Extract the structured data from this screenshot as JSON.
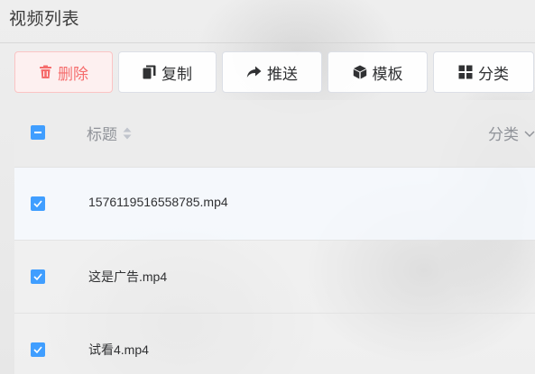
{
  "header": {
    "title": "视频列表"
  },
  "toolbar": {
    "delete_label": "删除",
    "copy_label": "复制",
    "push_label": "推送",
    "template_label": "模板",
    "category_label": "分类"
  },
  "table": {
    "columns": {
      "title": "标题",
      "category": "分类"
    },
    "rows": [
      {
        "title": "1576119516558785.mp4",
        "checked": true
      },
      {
        "title": "这是广告.mp4",
        "checked": true
      },
      {
        "title": "试看4.mp4",
        "checked": true
      }
    ]
  },
  "colors": {
    "primary": "#409eff",
    "danger": "#f56c6c",
    "danger_bg": "#fef0f0"
  },
  "icons": {
    "delete": "trash-icon",
    "copy": "copy-icon",
    "push": "share-arrow-icon",
    "template": "cube-icon",
    "category": "grid-icon",
    "sort": "sort-caret-icon",
    "category_filter": "chevron-down-icon"
  }
}
